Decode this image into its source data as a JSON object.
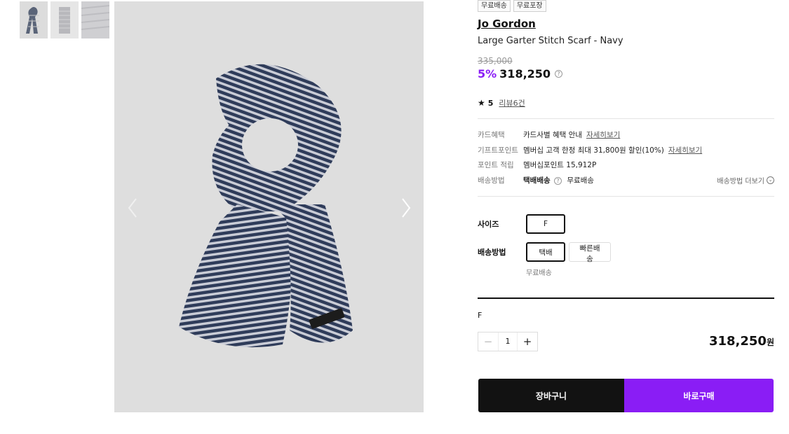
{
  "badges": [
    "무료배송",
    "무료포장"
  ],
  "product": {
    "brand": "Jo Gordon",
    "name": "Large Garter Stitch Scarf - Navy",
    "original_price": "335,000",
    "discount": "5%",
    "price": "318,250",
    "rating": "5",
    "review_link": "리뷰6건"
  },
  "info": {
    "card_label": "카드혜택",
    "card_value": "카드사별 혜택 안내",
    "card_link": "자세히보기",
    "gift_label": "기프트포인트",
    "gift_value": "멤버십 고객 한정 최대 31,800원 할인(10%)",
    "gift_link": "자세히보기",
    "point_label": "포인트 적립",
    "point_value": "멤버십포인트 15,912P",
    "ship_label": "배송방법",
    "ship_method": "택배배송",
    "ship_fee": "무료배송",
    "ship_more": "배송방법 더보기"
  },
  "options": {
    "size_label": "사이즈",
    "size_value": "F",
    "delivery_label": "배송방법",
    "delivery_selected": "택배",
    "delivery_fast": "빠른배송",
    "free_note": "무료배송"
  },
  "order": {
    "selected_option": "F",
    "quantity": "1",
    "total": "318,250",
    "currency": "원"
  },
  "buttons": {
    "cart": "장바구니",
    "buy": "바로구매"
  },
  "colors": {
    "accent": "#8a1df5",
    "dark": "#121212"
  }
}
